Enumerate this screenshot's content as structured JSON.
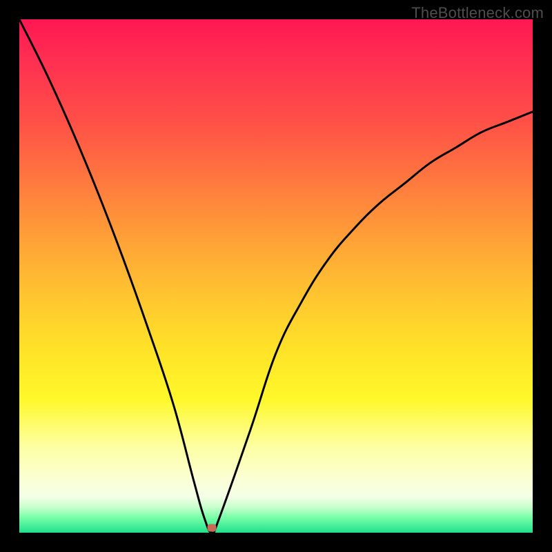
{
  "watermark": "TheBottleneck.com",
  "marker": {
    "x_percent": 37.5,
    "y_percent": 99.0,
    "color": "#c96a55"
  },
  "chart_data": {
    "type": "line",
    "title": "",
    "xlabel": "",
    "ylabel": "",
    "xlim": [
      0,
      100
    ],
    "ylim": [
      0,
      100
    ],
    "legend": false,
    "grid": false,
    "background": "rainbow-gradient (red top → green bottom)",
    "annotations": [
      {
        "text": "TheBottleneck.com",
        "position": "top-right",
        "role": "watermark"
      }
    ],
    "series": [
      {
        "name": "bottleneck-curve",
        "x": [
          0,
          5,
          10,
          15,
          20,
          25,
          30,
          34,
          36,
          37.5,
          39,
          45,
          50,
          55,
          60,
          65,
          70,
          75,
          80,
          85,
          90,
          95,
          100
        ],
        "values": [
          100,
          90,
          79,
          67,
          54,
          40,
          25,
          10,
          3,
          0,
          3,
          20,
          35,
          45,
          53,
          59,
          64,
          68,
          72,
          75,
          78,
          80,
          82
        ]
      }
    ],
    "marker_point": {
      "x": 37.5,
      "y": 0,
      "color": "#c96a55"
    }
  }
}
